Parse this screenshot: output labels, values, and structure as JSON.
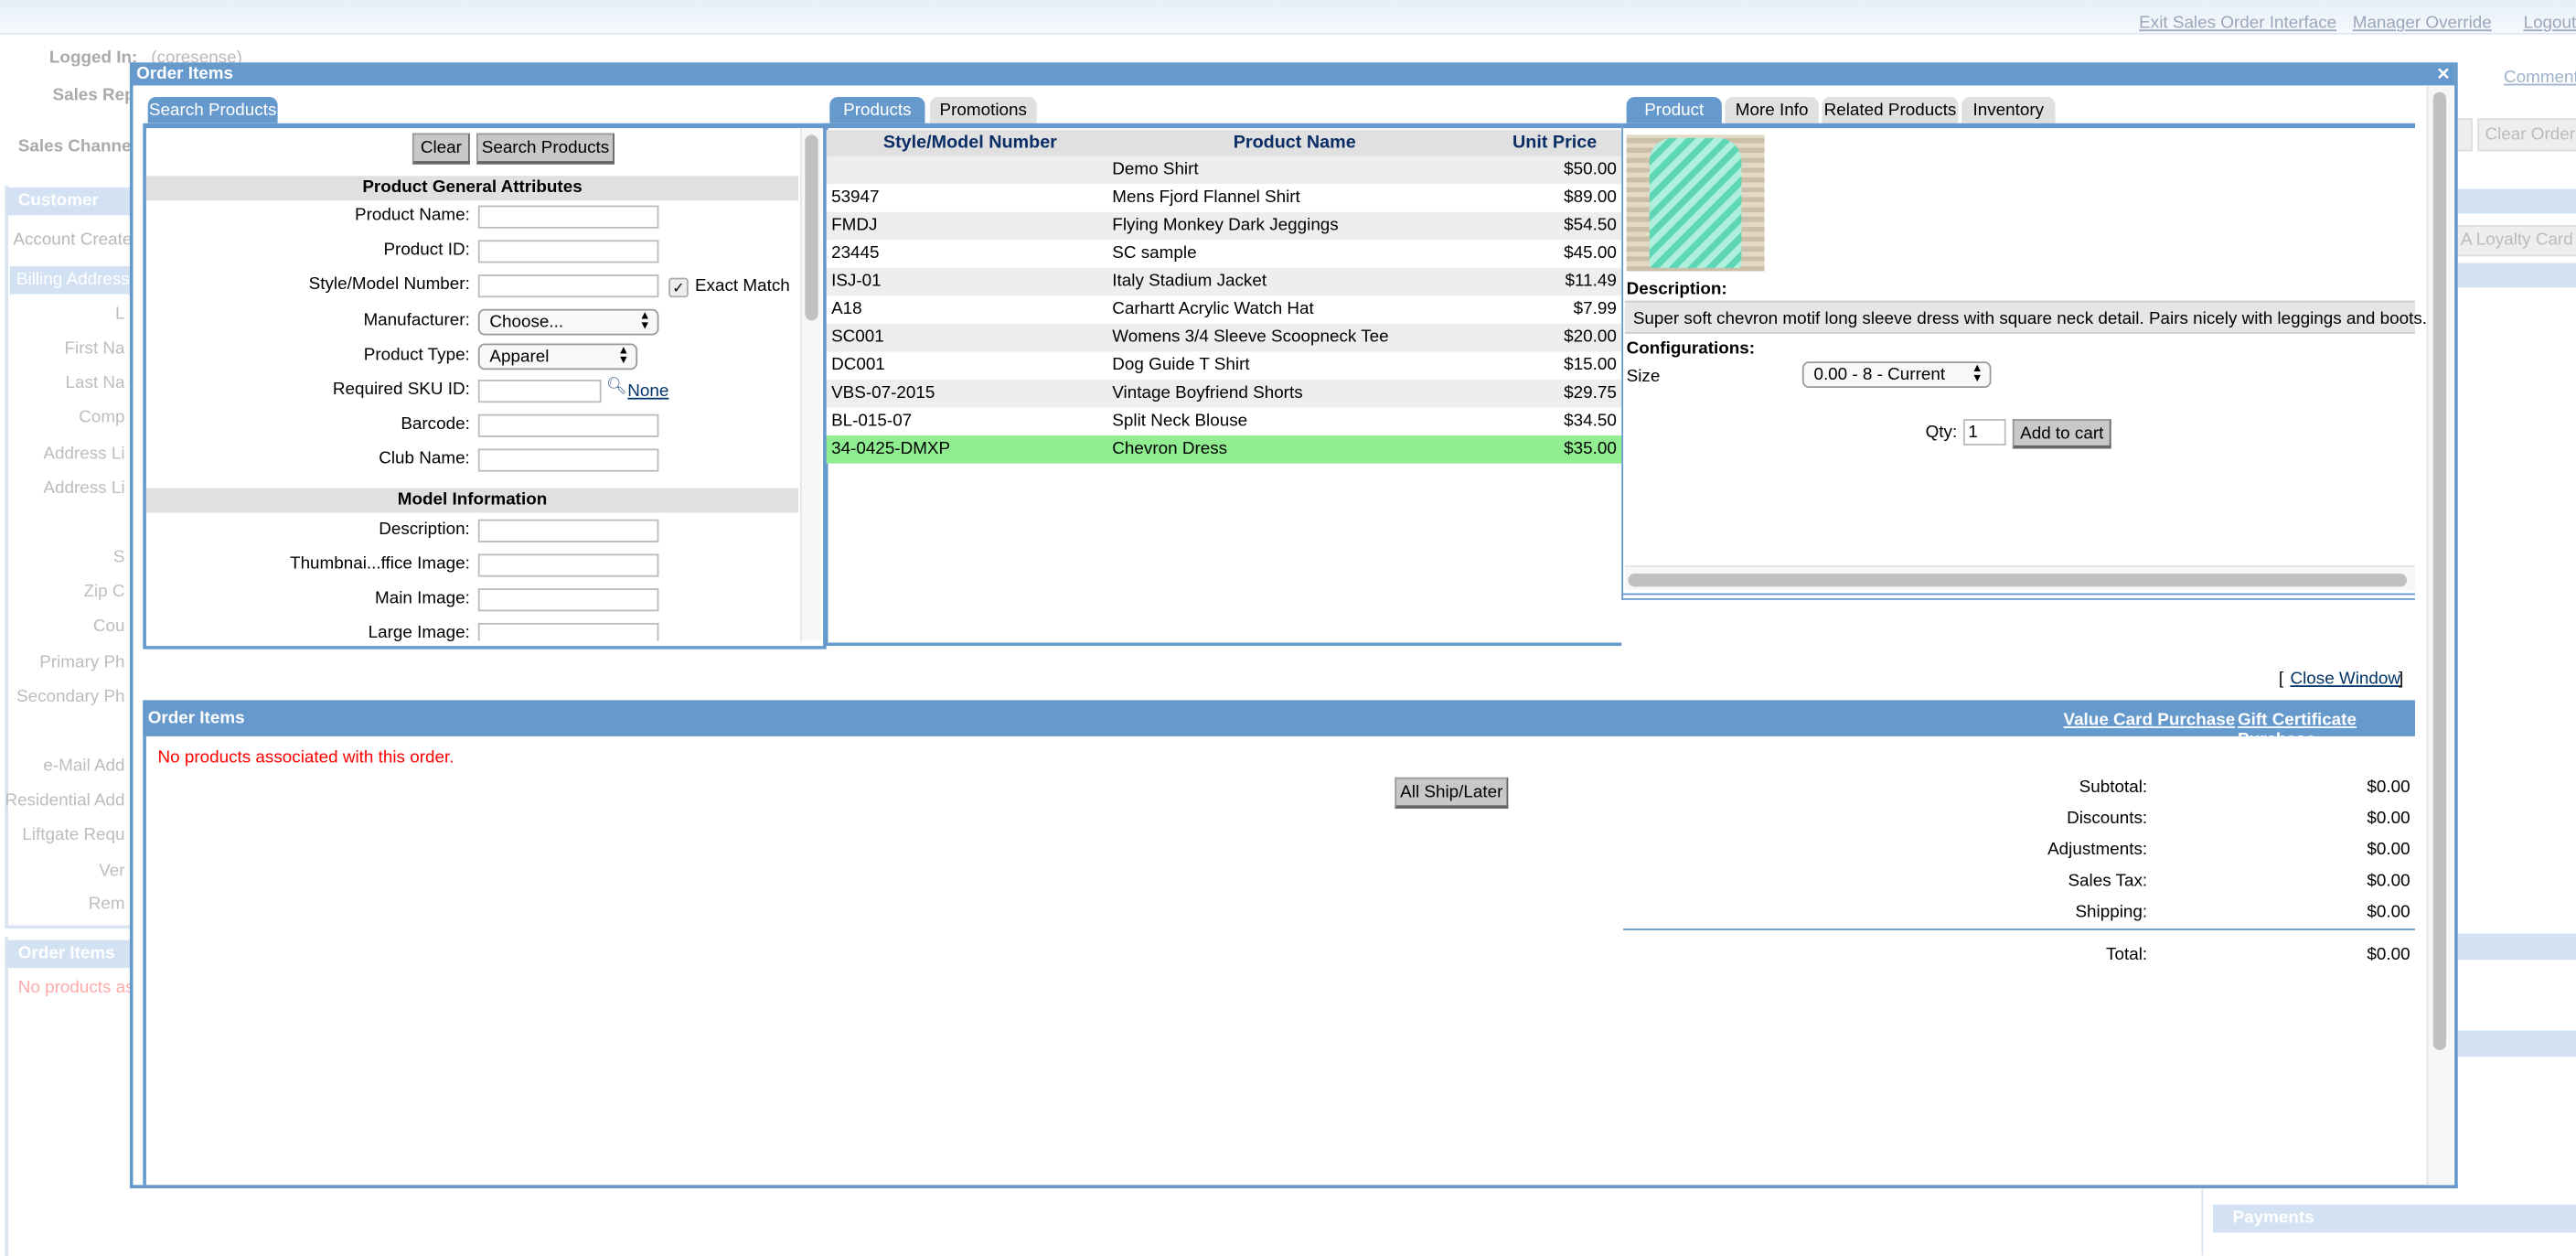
{
  "top_links": [
    "Exit Sales Order Interface",
    "Manager Override",
    "Logout"
  ],
  "background": {
    "logged_in_label": "Logged In:",
    "logged_in_value": "(coresense)",
    "sales_rep_label": "Sales Rep",
    "sales_channel_label": "Sales Channe",
    "customer_info": "Customer Info",
    "account_created": "Account Created",
    "billing_address": "Billing Address",
    "fields": [
      "L",
      "First Na",
      "Last Na",
      "Comp",
      "Address Li",
      "Address Li",
      "S",
      "Zip C",
      "Cou",
      "Primary Ph",
      "Secondary Ph",
      "e-Mail Add",
      "Residential Add",
      "Liftgate Requ",
      "Ver",
      "Rem"
    ],
    "order_items": "Order Items",
    "no_products": "No products as",
    "comments": "Comments",
    "clear_order": "Clear Order",
    "loyalty_card": "A Loyalty Card",
    "payments": "Payments"
  },
  "modal": {
    "title": "Order Items",
    "close_icon": "×",
    "search": {
      "tab": "Search Products",
      "clear_button": "Clear",
      "search_button": "Search Products",
      "general_header": "Product General Attributes",
      "product_name": "Product Name:",
      "product_id": "Product ID:",
      "style_model": "Style/Model Number:",
      "exact_match": "Exact Match",
      "exact_match_checked": true,
      "manufacturer": "Manufacturer:",
      "manufacturer_value": "Choose...",
      "product_type": "Product Type:",
      "product_type_value": "Apparel",
      "required_sku": "Required SKU ID:",
      "sku_none": "None",
      "barcode": "Barcode:",
      "club_name": "Club Name:",
      "model_header": "Model Information",
      "description": "Description:",
      "thumbnail": "Thumbnai...ffice Image:",
      "main_image": "Main Image:",
      "large_image": "Large Image:"
    },
    "products": {
      "tabs": [
        "Products",
        "Promotions"
      ],
      "columns": [
        "Style/Model Number",
        "Product Name",
        "Unit Price"
      ],
      "rows": [
        [
          "",
          "Demo Shirt",
          "$50.00"
        ],
        [
          "53947",
          "Mens Fjord Flannel Shirt",
          "$89.00"
        ],
        [
          "FMDJ",
          "Flying Monkey Dark Jeggings",
          "$54.50"
        ],
        [
          "23445",
          "SC sample",
          "$45.00"
        ],
        [
          "ISJ-01",
          "Italy Stadium Jacket",
          "$11.49"
        ],
        [
          "A18",
          "Carhartt Acrylic Watch Hat",
          "$7.99"
        ],
        [
          "SC001",
          "Womens 3/4 Sleeve Scoopneck Tee",
          "$20.00"
        ],
        [
          "DC001",
          "Dog Guide T Shirt",
          "$15.00"
        ],
        [
          "VBS-07-2015",
          "Vintage Boyfriend Shorts",
          "$29.75"
        ],
        [
          "BL-015-07",
          "Split Neck Blouse",
          "$34.50"
        ],
        [
          "34-0425-DMXP",
          "Chevron Dress",
          "$35.00"
        ]
      ],
      "selected_index": 10,
      "selected_color": "#90ee90"
    },
    "detail": {
      "tabs": [
        "Product",
        "More Info",
        "Related Products",
        "Inventory"
      ],
      "description_label": "Description:",
      "description": "Super soft chevron motif long sleeve dress with square neck detail. Pairs nicely with leggings and boots.",
      "configurations_label": "Configurations:",
      "size_label": "Size",
      "size_value": "0.00 - 8 - Current",
      "qty_label": "Qty:",
      "qty_value": "1",
      "add_to_cart": "Add to cart"
    },
    "close_window_open": "[",
    "close_window": "Close Window",
    "close_window_close": "]",
    "order_items": {
      "title": "Order Items",
      "value_card": "Value Card Purchase",
      "gift_certificate": "Gift Certificate Purchase",
      "empty_message": "No products associated with this order.",
      "ship_later_button": "All Ship/Later",
      "totals": [
        {
          "label": "Subtotal:",
          "value": "$0.00"
        },
        {
          "label": "Discounts:",
          "value": "$0.00"
        },
        {
          "label": "Adjustments:",
          "value": "$0.00"
        },
        {
          "label": "Sales Tax:",
          "value": "$0.00"
        },
        {
          "label": "Shipping:",
          "value": "$0.00"
        }
      ],
      "total_label": "Total:",
      "total_value": "$0.00"
    }
  },
  "colors": {
    "accent": "#6699cc",
    "error": "#ff0000",
    "link": "#003366"
  }
}
